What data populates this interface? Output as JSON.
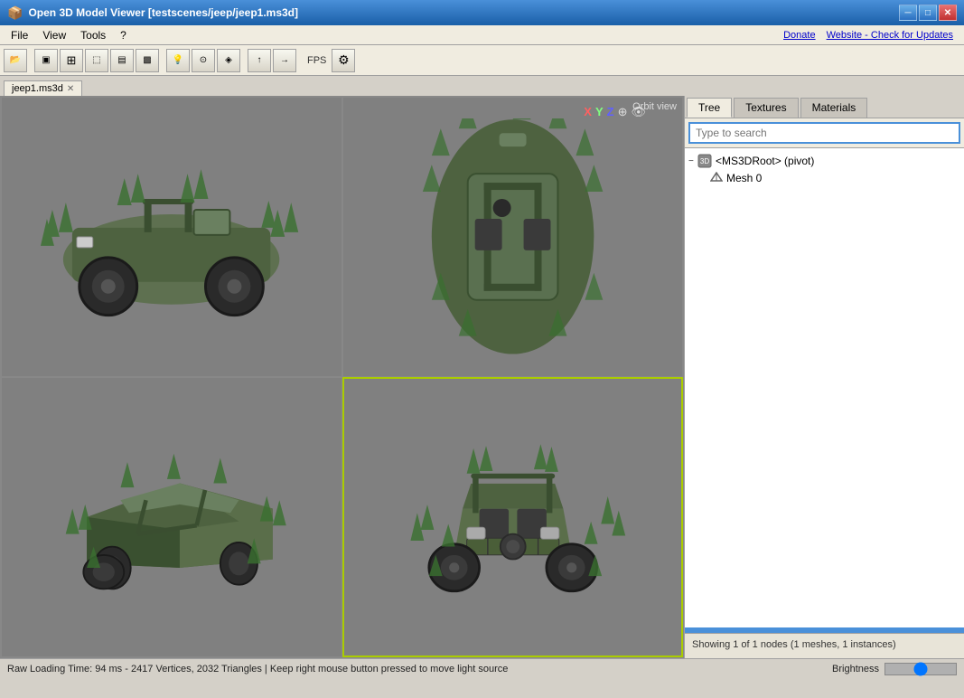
{
  "window": {
    "title": "Open 3D Model Viewer  [testscenes/jeep/jeep1.ms3d]",
    "icon": "3d-box"
  },
  "titlebar": {
    "minimize_label": "─",
    "maximize_label": "□",
    "close_label": "✕"
  },
  "menubar": {
    "items": [
      "File",
      "View",
      "Tools",
      "?"
    ],
    "links": {
      "donate": "Donate",
      "website": "Website - Check for Updates"
    }
  },
  "toolbar": {
    "fps_label": "FPS",
    "buttons": [
      {
        "name": "open",
        "icon": "📂"
      },
      {
        "name": "single-view",
        "icon": "▣"
      },
      {
        "name": "quad-view",
        "icon": "⊞"
      },
      {
        "name": "wireframe",
        "icon": "⬚"
      },
      {
        "name": "flat",
        "icon": "⬛"
      },
      {
        "name": "textured",
        "icon": "▤"
      },
      {
        "name": "light",
        "icon": "💡"
      },
      {
        "name": "camera",
        "icon": "⊙"
      },
      {
        "name": "bones",
        "icon": "◈"
      },
      {
        "name": "normals",
        "icon": "↑"
      },
      {
        "name": "settings",
        "icon": "⚙"
      }
    ]
  },
  "tabs": [
    {
      "label": "jeep1.ms3d",
      "active": true
    }
  ],
  "viewports": {
    "axes": {
      "x": "X",
      "y": "Y",
      "z": "Z"
    },
    "orbit_label": "Orbit view",
    "quadrants": [
      {
        "id": "top-left",
        "active": false
      },
      {
        "id": "top-right",
        "active": false
      },
      {
        "id": "bottom-left",
        "active": false
      },
      {
        "id": "bottom-right",
        "active": true
      }
    ]
  },
  "right_panel": {
    "tabs": [
      {
        "label": "Tree",
        "active": true
      },
      {
        "label": "Textures",
        "active": false
      },
      {
        "label": "Materials",
        "active": false
      }
    ],
    "search": {
      "placeholder": "Type to search",
      "value": ""
    },
    "tree": {
      "root": {
        "label": "<MS3DRoot> (pivot)",
        "expanded": true,
        "children": [
          {
            "label": "Mesh 0"
          }
        ]
      }
    },
    "status": "Showing 1 of 1 nodes (1 meshes, 1 instances)"
  },
  "statusbar": {
    "text": "Raw Loading Time: 94 ms - 2417 Vertices, 2032 Triangles  |  Keep right mouse button pressed to move light source",
    "brightness_label": "Brightness"
  }
}
